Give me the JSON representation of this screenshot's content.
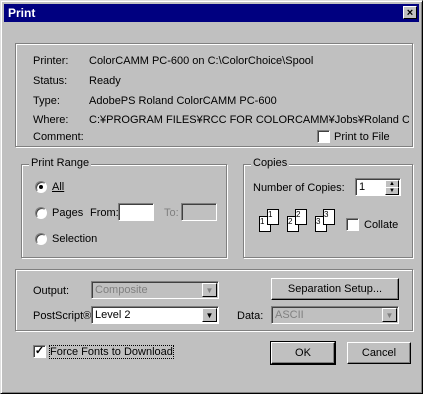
{
  "window": {
    "title": "Print",
    "close_glyph": "×"
  },
  "printer_info": {
    "printer_label": "Printer:",
    "printer_value": "ColorCAMM PC-600 on C:\\ColorChoice\\Spool",
    "status_label": "Status:",
    "status_value": "Ready",
    "type_label": "Type:",
    "type_value": "AdobePS Roland ColorCAMM PC-600",
    "where_label": "Where:",
    "where_value": "C:¥PROGRAM FILES¥RCC FOR COLORCAMM¥Jobs¥Roland Colo",
    "comment_label": "Comment:",
    "print_to_file_label": "Print to File",
    "print_to_file_checked": false
  },
  "print_range": {
    "legend": "Print Range",
    "all_label": "All",
    "pages_label": "Pages",
    "from_label": "From:",
    "from_value": "",
    "to_label": "To:",
    "to_value": "",
    "selection_label": "Selection",
    "selected": "all"
  },
  "copies": {
    "legend": "Copies",
    "number_label": "Number of Copies:",
    "number_value": "1",
    "collate_label": "Collate",
    "collate_checked": false,
    "page_numbers": [
      "1",
      "1",
      "2",
      "2",
      "3",
      "3"
    ]
  },
  "options": {
    "output_label": "Output:",
    "output_value": "Composite",
    "separation_button": "Separation Setup...",
    "postscript_label": "PostScript®:",
    "postscript_value": "Level 2",
    "data_label": "Data:",
    "data_value": "ASCII"
  },
  "footer": {
    "force_fonts_label": "Force Fonts to Download",
    "force_fonts_checked": true,
    "ok_label": "OK",
    "cancel_label": "Cancel"
  }
}
